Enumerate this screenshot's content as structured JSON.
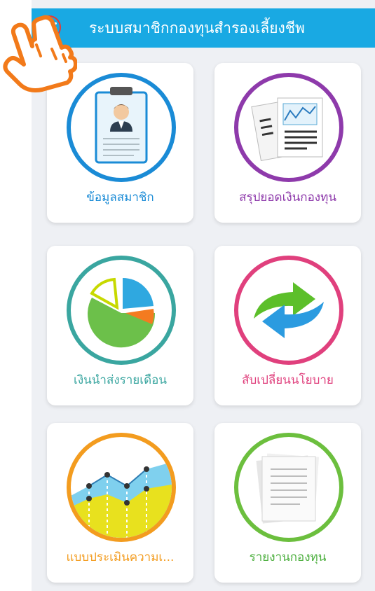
{
  "header": {
    "title": "ระบบสมาชิกกองทุนสำรองเลี้ยงชีพ"
  },
  "colors": {
    "header_bg": "#19a9e3",
    "member_info": "#1a8bd6",
    "fund_summary": "#8e3aab",
    "monthly_contribution": "#3aa6a0",
    "switch_policy": "#e0407d",
    "risk_assessment": "#f39c1f",
    "fund_report": "#6cbf3e"
  },
  "menu_items": [
    {
      "label": "ข้อมูลสมาชิก",
      "icon": "clipboard-member-icon"
    },
    {
      "label": "สรุปยอดเงินกองทุน",
      "icon": "documents-chart-icon"
    },
    {
      "label": "เงินนำส่งรายเดือน",
      "icon": "pie-chart-icon"
    },
    {
      "label": "สับเปลี่ยนนโยบาย",
      "icon": "switch-arrows-icon"
    },
    {
      "label": "แบบประเมินความเ...",
      "icon": "area-chart-icon"
    },
    {
      "label": "รายงานกองทุน",
      "icon": "report-papers-icon"
    }
  ]
}
